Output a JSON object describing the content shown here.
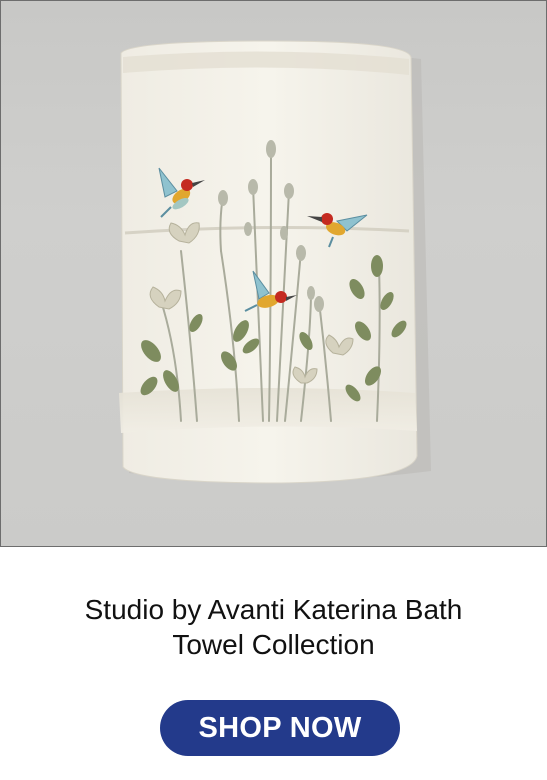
{
  "product": {
    "image_alt": "Studio by Avanti Katerina bath towel with embroidered hummingbirds",
    "title_line1": "Studio by Avanti Katerina Bath",
    "title_line2": "Towel Collection"
  },
  "cta": {
    "label": "SHOP NOW"
  },
  "colors": {
    "button_bg": "#233a8b",
    "button_text": "#ffffff",
    "title_text": "#111111",
    "frame_border": "#6d6d6d"
  }
}
